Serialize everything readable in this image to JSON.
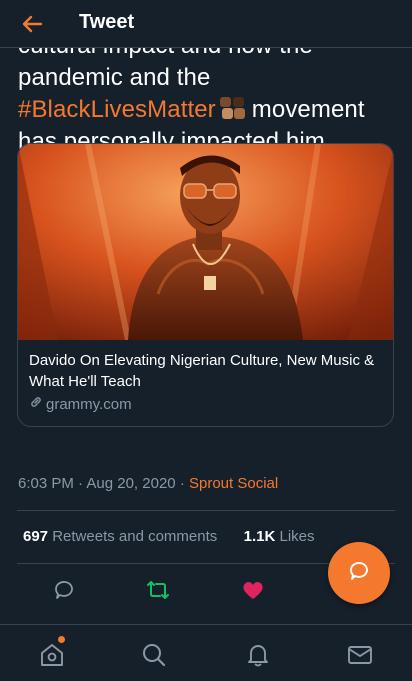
{
  "header": {
    "title": "Tweet"
  },
  "tweet": {
    "line1": "cultural impact and how the",
    "line2": "pandemic and the",
    "hashtag": "#BlackLivesMatter",
    "line3_rest": "movement",
    "line4": "has personally impacted him."
  },
  "card": {
    "title": "Davido On Elevating Nigerian Culture, New Music & What He'll Teach",
    "domain": "grammy.com"
  },
  "meta": {
    "time": "6:03 PM",
    "sep1": "·",
    "date": "Aug 20, 2020",
    "sep2": "·",
    "source": "Sprout Social"
  },
  "stats": {
    "retweets_count": "697",
    "retweets_label": "Retweets and comments",
    "likes_count": "1.1K",
    "likes_label": "Likes"
  },
  "colors": {
    "accent": "#f4792e",
    "retweet_active": "#17bf63",
    "like_active": "#e0245e",
    "background": "#15202b"
  },
  "icons": [
    "back-arrow-icon",
    "link-icon",
    "reply-icon",
    "retweet-icon",
    "heart-icon",
    "compose-icon",
    "home-icon",
    "search-icon",
    "notifications-icon",
    "messages-icon"
  ]
}
